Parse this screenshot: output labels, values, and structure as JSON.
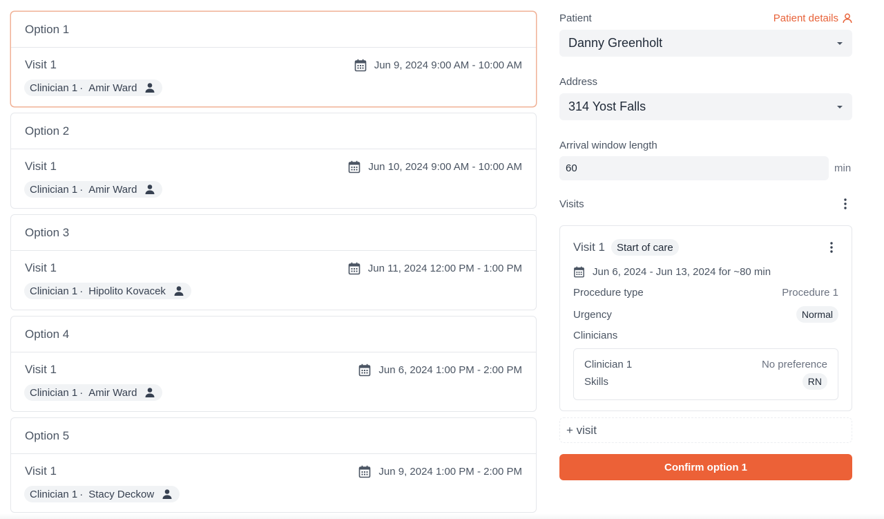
{
  "options": [
    {
      "title": "Option 1",
      "selected": true,
      "visit": {
        "name": "Visit 1",
        "date": "Jun 9, 2024 9:00 AM - 10:00 AM",
        "clinician_role": "Clinician 1",
        "clinician_name": "Amir Ward"
      }
    },
    {
      "title": "Option 2",
      "selected": false,
      "visit": {
        "name": "Visit 1",
        "date": "Jun 10, 2024 9:00 AM - 10:00 AM",
        "clinician_role": "Clinician 1",
        "clinician_name": "Amir Ward"
      }
    },
    {
      "title": "Option 3",
      "selected": false,
      "visit": {
        "name": "Visit 1",
        "date": "Jun 11, 2024 12:00 PM - 1:00 PM",
        "clinician_role": "Clinician 1",
        "clinician_name": "Hipolito Kovacek"
      }
    },
    {
      "title": "Option 4",
      "selected": false,
      "visit": {
        "name": "Visit 1",
        "date": "Jun 6, 2024 1:00 PM - 2:00 PM",
        "clinician_role": "Clinician 1",
        "clinician_name": "Amir Ward"
      }
    },
    {
      "title": "Option 5",
      "selected": false,
      "visit": {
        "name": "Visit 1",
        "date": "Jun 9, 2024 1:00 PM - 2:00 PM",
        "clinician_role": "Clinician 1",
        "clinician_name": "Stacy Deckow"
      }
    }
  ],
  "chip_separator": "·",
  "panel": {
    "patient_label": "Patient",
    "patient_details_link": "Patient details",
    "patient_value": "Danny Greenholt",
    "address_label": "Address",
    "address_value": "314 Yost Falls",
    "arrival_label": "Arrival window length",
    "arrival_value": "60",
    "arrival_unit": "min",
    "visits_label": "Visits",
    "visit_card": {
      "name": "Visit 1",
      "tag": "Start of care",
      "date_range": "Jun 6, 2024 - Jun 13, 2024 for ~80 min",
      "procedure_label": "Procedure type",
      "procedure_value": "Procedure 1",
      "urgency_label": "Urgency",
      "urgency_value": "Normal",
      "clinicians_label": "Clinicians",
      "clinician_name": "Clinician 1",
      "clinician_preference": "No preference",
      "skills_label": "Skills",
      "skills_value": "RN"
    },
    "add_visit_label": "+ visit",
    "confirm_label": "Confirm option 1"
  },
  "colors": {
    "accent": "#ec6137",
    "link": "#e8633a",
    "selected_border": "#f0b196"
  }
}
